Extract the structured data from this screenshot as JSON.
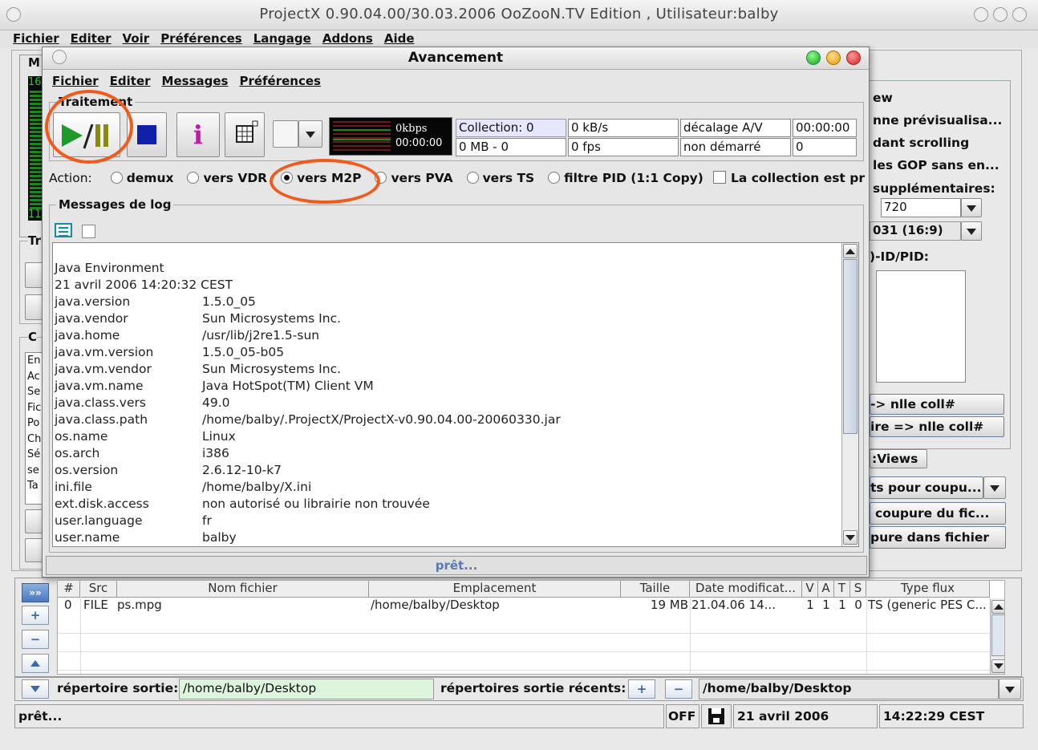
{
  "window": {
    "title": "ProjectX 0.90.04.00/30.03.2006 OoZooN.TV Edition , Utilisateur:balby"
  },
  "main_menu": [
    "Fichier",
    "Editer",
    "Voir",
    "Préférences",
    "Langage",
    "Addons",
    "Aide"
  ],
  "left_peek": {
    "top_label": "M",
    "num_top": "16",
    "num_bottom": "11",
    "label_tr": "Tr",
    "label_c": "C",
    "list": [
      "En",
      "Ac",
      "Se",
      "Fic",
      "Po",
      "Ch",
      "Sé",
      "se",
      "Ta"
    ]
  },
  "right_peek": {
    "lines": [
      "ew",
      "nne prévisualisa...",
      "dant scrolling",
      "les GOP sans en...",
      "supplémentaires:"
    ],
    "combo1": "720",
    "combo2": "031 (16:9)",
    "pid_label": ")-ID/PID:",
    "btn1": "-> nlle coll#",
    "btn2": "ire => nlle coll#",
    "views": ":Views",
    "combo3": "ts pour coupu...",
    "btn3": "coupure du fic...",
    "btn4": "pure dans fichier"
  },
  "dialog": {
    "title": "Avancement",
    "menu": [
      "Fichier",
      "Editer",
      "Messages",
      "Préférences"
    ],
    "section_traitement": "Traitement",
    "meter": {
      "kbps": "0kbps",
      "time": "00:00:00"
    },
    "stats": {
      "collection": "Collection: 0",
      "kbs": "0 kB/s",
      "decalage": "décalage A/V",
      "decalage_val": "00:00:00",
      "mb": "0 MB - 0",
      "fps": "0 fps",
      "status": "non démarré",
      "status_val": "0"
    },
    "action_label": "Action:",
    "actions": [
      {
        "label": "demux",
        "selected": false
      },
      {
        "label": "vers VDR",
        "selected": false
      },
      {
        "label": "vers M2P",
        "selected": true
      },
      {
        "label": "vers PVA",
        "selected": false
      },
      {
        "label": "vers TS",
        "selected": false
      },
      {
        "label": "filtre PID (1:1 Copy)",
        "selected": false
      }
    ],
    "collection_checkbox": "La collection est pri",
    "log_section": "Messages de log",
    "log_lines": [
      {
        "k": "",
        "v": ""
      },
      {
        "k": "Java Environment",
        "v": ""
      },
      {
        "k": "21 avril 2006    14:20:32 CEST",
        "v": ""
      },
      {
        "k": "java.version",
        "v": "1.5.0_05"
      },
      {
        "k": "java.vendor",
        "v": "Sun Microsystems Inc."
      },
      {
        "k": "java.home",
        "v": "/usr/lib/j2re1.5-sun"
      },
      {
        "k": "java.vm.version",
        "v": "1.5.0_05-b05"
      },
      {
        "k": "java.vm.vendor",
        "v": "Sun Microsystems Inc."
      },
      {
        "k": "java.vm.name",
        "v": "Java HotSpot(TM) Client VM"
      },
      {
        "k": "java.class.vers",
        "v": "49.0"
      },
      {
        "k": "java.class.path",
        "v": "/home/balby/.ProjectX/ProjectX-v0.90.04.00-20060330.jar"
      },
      {
        "k": "os.name",
        "v": "Linux"
      },
      {
        "k": "os.arch",
        "v": "i386"
      },
      {
        "k": "os.version",
        "v": "2.6.12-10-k7"
      },
      {
        "k": "ini.file",
        "v": "/home/balby/X.ini"
      },
      {
        "k": "ext.disk.access",
        "v": "non autorisé ou librairie non trouvée"
      },
      {
        "k": "user.language",
        "v": "fr"
      },
      {
        "k": "user.name",
        "v": "balby"
      }
    ],
    "status_text": "prêt..."
  },
  "table": {
    "headers": [
      "#",
      "Src",
      "Nom fichier",
      "Emplacement",
      "Taille",
      "Date modificat...",
      "V",
      "A",
      "T",
      "S",
      "Type flux"
    ],
    "rows": [
      [
        "0",
        "FILE",
        "ps.mpg",
        "/home/balby/Desktop",
        "19 MB",
        "21.04.06  14...",
        "1",
        "1",
        "1",
        "0",
        "TS (generic PES C..."
      ]
    ]
  },
  "output": {
    "label": "répertoire sortie:",
    "value": "/home/balby/Desktop",
    "recent_label": "répertoires sortie récents:",
    "recent_value": "/home/balby/Desktop"
  },
  "statusbar": {
    "text": "prêt...",
    "off": "OFF",
    "date": "21 avril 2006",
    "time": "14:22:29 CEST"
  },
  "colors": {
    "annotation": "#f05a1a",
    "play_green": "#1c9a2a",
    "pause_olive": "#8a8a10",
    "info_magenta": "#c21aa8",
    "stop_blue": "#1020a8"
  }
}
